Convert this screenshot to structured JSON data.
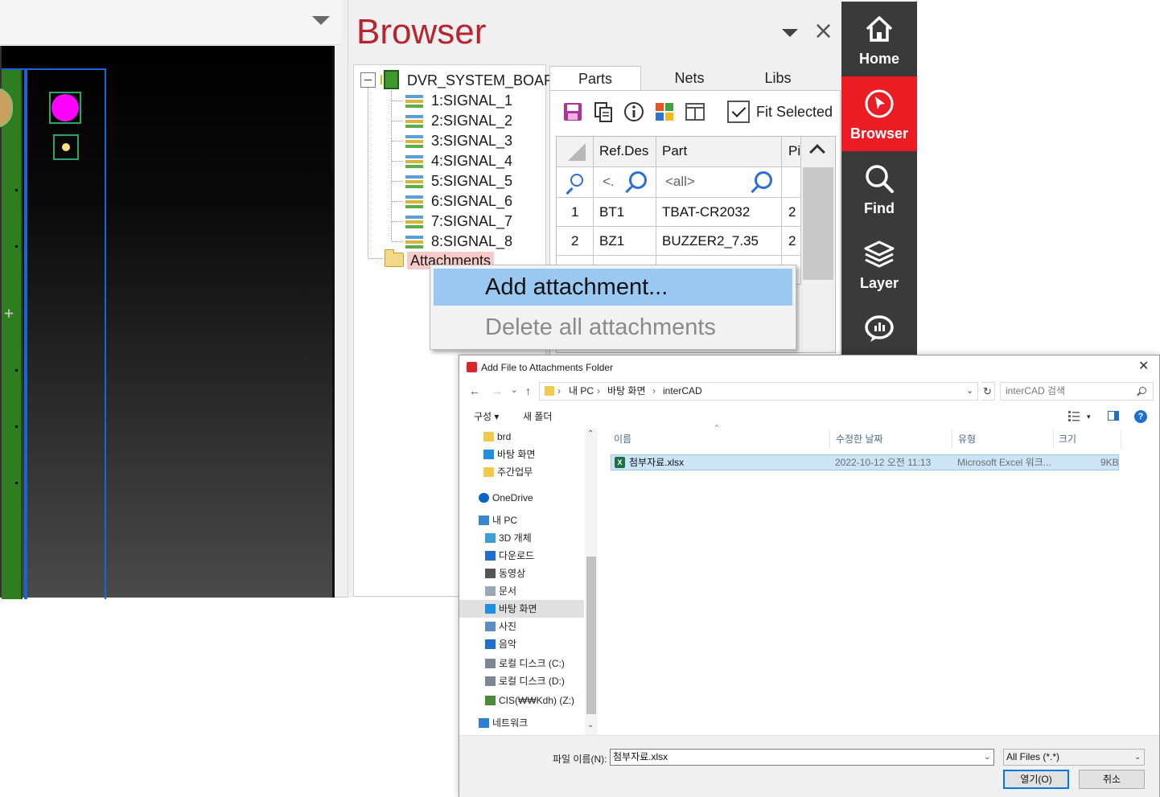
{
  "browser_panel": {
    "title": "Browser",
    "close_glyph": "×",
    "tree": {
      "root": "DVR_SYSTEM_BOARD",
      "layers": [
        "1:SIGNAL_1",
        "2:SIGNAL_2",
        "3:SIGNAL_3",
        "4:SIGNAL_4",
        "5:SIGNAL_5",
        "6:SIGNAL_6",
        "7:SIGNAL_7",
        "8:SIGNAL_8"
      ],
      "attachments": "Attachments"
    },
    "tabs": [
      "Parts",
      "Nets",
      "Libs"
    ],
    "toolbar": {
      "fit_selected": "Fit Selected",
      "icons": [
        "save-icon",
        "copy-icon",
        "info-icon",
        "color-grid-icon",
        "columns-icon"
      ]
    },
    "grid": {
      "headers": {
        "ref": "Ref.Des",
        "part": "Part",
        "pin": "Pi"
      },
      "filter": {
        "ref": "<.",
        "part": "<all>"
      },
      "rows": [
        {
          "num": "1",
          "ref": "BT1",
          "part": "TBAT-CR2032",
          "pin": "2"
        },
        {
          "num": "2",
          "ref": "BZ1",
          "part": "BUZZER2_7.35",
          "pin": "2"
        }
      ]
    }
  },
  "right_nav": [
    {
      "label": "Home",
      "icon": "home-icon",
      "active": false
    },
    {
      "label": "Browser",
      "icon": "cursor-icon",
      "active": true
    },
    {
      "label": "Find",
      "icon": "search-icon",
      "active": false
    },
    {
      "label": "Layer",
      "icon": "layers-icon",
      "active": false
    },
    {
      "label": "",
      "icon": "chat-icon",
      "active": false
    }
  ],
  "context_menu": {
    "add": "Add attachment...",
    "delete": "Delete all attachments"
  },
  "dialog": {
    "title": "Add File to Attachments Folder",
    "address": [
      "내 PC",
      "바탕 화면",
      "interCAD"
    ],
    "search_placeholder": "interCAD 검색",
    "commands": {
      "organize": "구성 ▾",
      "new_folder": "새 폴더"
    },
    "nav_pane": [
      {
        "label": "brd",
        "icon": "folder-icon"
      },
      {
        "label": "바탕 화면",
        "icon": "desktop-icon"
      },
      {
        "label": "주간업무",
        "icon": "folder-icon"
      },
      {
        "label": "OneDrive",
        "icon": "cloud-icon"
      },
      {
        "label": "내 PC",
        "icon": "pc-icon"
      },
      {
        "label": "3D 개체",
        "icon": "cube-icon"
      },
      {
        "label": "다운로드",
        "icon": "download-icon"
      },
      {
        "label": "동영상",
        "icon": "video-icon"
      },
      {
        "label": "문서",
        "icon": "document-icon"
      },
      {
        "label": "바탕 화면",
        "icon": "desktop-icon"
      },
      {
        "label": "사진",
        "icon": "picture-icon"
      },
      {
        "label": "음악",
        "icon": "music-icon"
      },
      {
        "label": "로컬 디스크 (C:)",
        "icon": "drive-icon"
      },
      {
        "label": "로컬 디스크 (D:)",
        "icon": "drive-icon"
      },
      {
        "label": "CIS(₩₩Kdh) (Z:)",
        "icon": "network-drive-icon"
      },
      {
        "label": "네트워크",
        "icon": "network-icon"
      }
    ],
    "columns": {
      "name": "이름",
      "date": "수정한 날짜",
      "type": "유형",
      "size": "크기"
    },
    "files": [
      {
        "name": "첨부자료.xlsx",
        "date": "2022-10-12 오전 11:13",
        "type": "Microsoft Excel 워크...",
        "size": "9KB"
      }
    ],
    "filename_label": "파일 이름(N):",
    "filename_value": "첨부자료.xlsx",
    "filetype": "All Files (*.*)",
    "open": "열기(O)",
    "cancel": "취소"
  }
}
